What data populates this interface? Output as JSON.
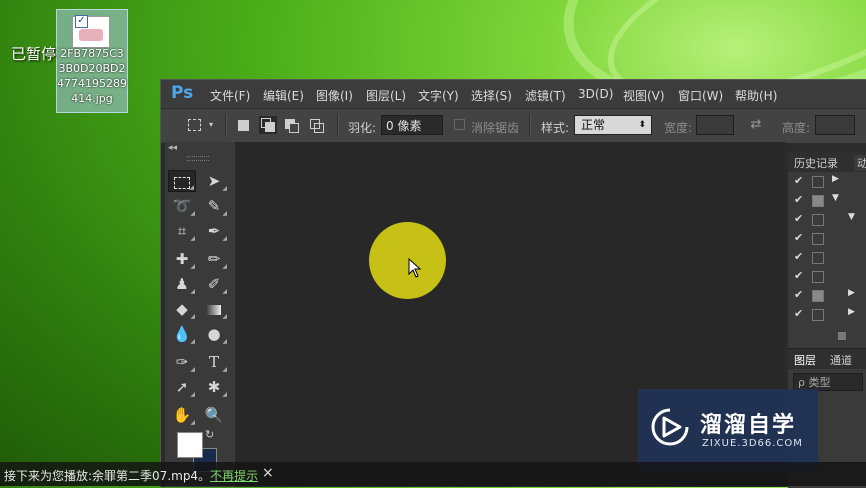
{
  "desktop": {
    "paused_label": "已暂停",
    "icon_name": "2FB7875C33B0D20BD24774195289414.jpg"
  },
  "photoshop": {
    "logo": "Ps",
    "menu": [
      "文件(F)",
      "编辑(E)",
      "图像(I)",
      "图层(L)",
      "文字(Y)",
      "选择(S)",
      "滤镜(T)",
      "3D(D)",
      "视图(V)",
      "窗口(W)",
      "帮助(H)"
    ],
    "options": {
      "feather_label": "羽化:",
      "feather_value": "0 像素",
      "antialias_label": "消除锯齿",
      "style_label": "样式:",
      "style_value": "正常",
      "width_label": "宽度:",
      "height_label": "高度:"
    },
    "panels": {
      "history_tab": "历史记录",
      "history_tab2": "动",
      "layers_tab": "图层",
      "channels_tab": "通道",
      "layers_search": "ρ 类型"
    }
  },
  "watermark": {
    "title": "溜溜自学",
    "url": "ZIXUE.3D66.COM"
  },
  "status": {
    "text": "接下来为您播放:余罪第二季07.mp4。",
    "link": "不再提示",
    "close": "×"
  }
}
